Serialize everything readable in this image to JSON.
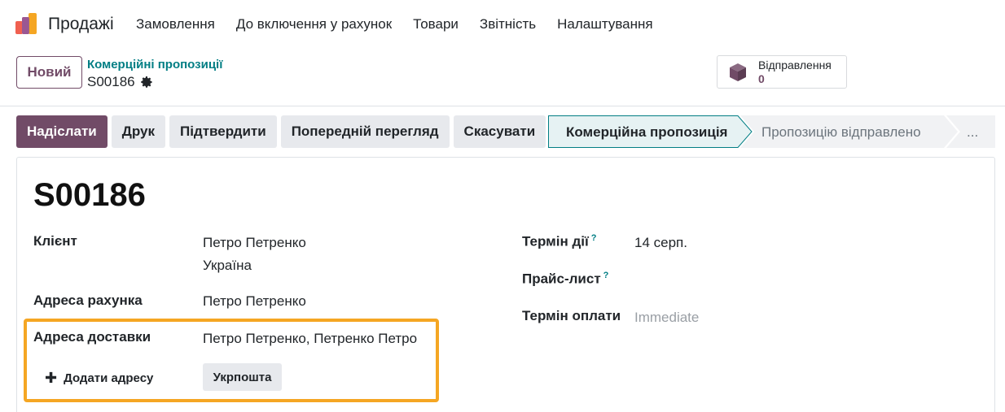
{
  "app": {
    "name": "Продажі"
  },
  "menu": [
    "Замовлення",
    "До включення у рахунок",
    "Товари",
    "Звітність",
    "Налаштування"
  ],
  "control": {
    "new_button": "Новий",
    "breadcrumb": "Комерційні пропозиції",
    "record": "S00186"
  },
  "smart_button": {
    "label": "Відправлення",
    "count": "0"
  },
  "actions": [
    "Надіслати",
    "Друк",
    "Підтвердити",
    "Попередній перегляд",
    "Скасувати"
  ],
  "status": {
    "active": "Комерційна пропозиція",
    "next": "Пропозицію відправлено",
    "more": "..."
  },
  "form": {
    "title": "S00186",
    "customer_label": "Клієнт",
    "customer_name": "Петро Петренко",
    "customer_country": "Україна",
    "invoice_label": "Адреса рахунка",
    "invoice_value": "Петро Петренко",
    "delivery_label": "Адреса доставки",
    "delivery_value": "Петро Петренко, Петренко Петро",
    "add_address": "Додати адресу",
    "carrier_tag": "Укрпошта",
    "validity_label": "Термін дії",
    "validity_value": "14 серп.",
    "pricelist_label": "Прайс-лист",
    "payment_label": "Термін оплати",
    "payment_placeholder": "Immediate",
    "help_mark": "?"
  },
  "colors": {
    "brand": "#714B67",
    "accent": "#017e84",
    "highlight": "#f5a623"
  },
  "icons": {
    "logo": "odoo-sales-logo",
    "gear": "gear-icon",
    "box": "package-icon",
    "plus": "plus-icon"
  }
}
